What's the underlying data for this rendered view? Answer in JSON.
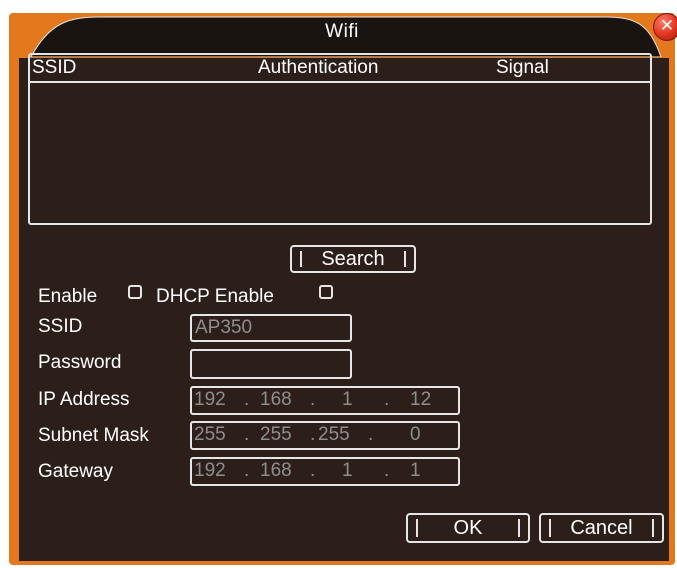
{
  "window": {
    "title": "Wifi"
  },
  "list": {
    "columns": [
      "SSID",
      "Authentication",
      "Signal"
    ],
    "rows": []
  },
  "buttons": {
    "search": "Search",
    "ok": "OK",
    "cancel": "Cancel"
  },
  "toggles": {
    "enable_label": "Enable",
    "enable_checked": false,
    "dhcp_label": "DHCP Enable",
    "dhcp_checked": false
  },
  "form": {
    "ssid_label": "SSID",
    "ssid_value": "AP350",
    "password_label": "Password",
    "password_value": "",
    "ip_label": "IP Address",
    "ip": [
      "192",
      "168",
      "1",
      "12"
    ],
    "mask_label": "Subnet Mask",
    "mask": [
      "255",
      "255",
      "255",
      "0"
    ],
    "gateway_label": "Gateway",
    "gateway": [
      "192",
      "168",
      "1",
      "1"
    ],
    "ip_separator": "."
  },
  "colors": {
    "frame": "#e3781c",
    "panel": "#2c1f1a",
    "border": "#e6e6e6",
    "disabled_text": "#8e8e8e"
  },
  "icons": {
    "close": "close-icon"
  }
}
